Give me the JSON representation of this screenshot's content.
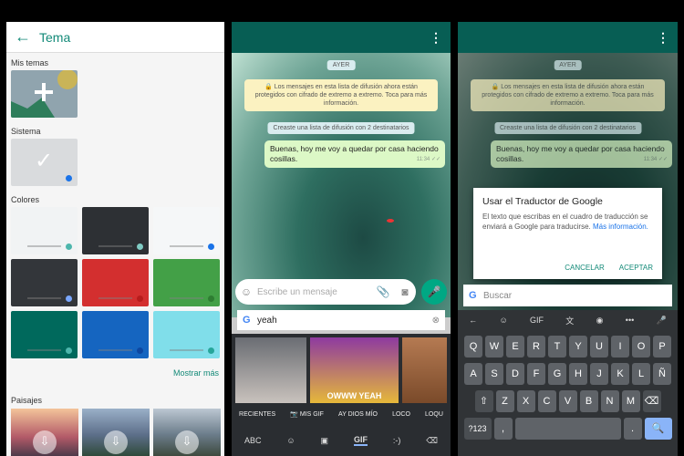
{
  "theme_panel": {
    "title": "Tema",
    "sections": {
      "my_themes": "Mis temas",
      "system": "Sistema",
      "colors": "Colores",
      "landscapes": "Paisajes"
    },
    "show_more": "Mostrar más",
    "color_tiles": [
      {
        "bg": "#f1f3f4",
        "dot": "#4db6ac"
      },
      {
        "bg": "#2d3034",
        "dot": "#80cbc4"
      },
      {
        "bg": "#f5f7f8",
        "dot": "#1a73e8"
      },
      {
        "bg": "#33363a",
        "dot": "#7aa7ff"
      },
      {
        "bg": "#d32f2f",
        "dot": "#b71c1c"
      },
      {
        "bg": "#43a047",
        "dot": "#2e7d32"
      },
      {
        "bg": "#00695c",
        "dot": "#4db6ac"
      },
      {
        "bg": "#1565c0",
        "dot": "#0d47a1"
      },
      {
        "bg": "#80deea",
        "dot": "#26a69a"
      }
    ]
  },
  "chat_gif": {
    "date_chip": "AYER",
    "system_msg": "🔒 Los mensajes en esta lista de difusión ahora están protegidos con cifrado de extremo a extremo. Toca para más información.",
    "broadcast_note": "Creaste una lista de difusión con 2 destinatarios",
    "bubble_text": "Buenas, hoy me voy a quedar por casa haciendo cosillas.",
    "bubble_time": "11:34 ✓✓",
    "input_placeholder": "Escribe un mensaje",
    "search_value": "yeah",
    "gif_caption": "OWWW YEAH",
    "categories": [
      "RECIENTES",
      "📷 MIS GIF",
      "AY DIOS MÍO",
      "LOCO",
      "LOQU"
    ],
    "nav": [
      "ABC",
      "☺",
      "▣",
      "GIF",
      ":-)",
      "⌫"
    ]
  },
  "chat_translate": {
    "dialog_title": "Usar el Traductor de Google",
    "dialog_body": "El texto que escribas en el cuadro de traducción se enviará a Google para traducirse.",
    "dialog_link": "Más información.",
    "cancel": "CANCELAR",
    "accept": "ACEPTAR",
    "search_placeholder": "Buscar",
    "tool_icons": [
      "←",
      "☺",
      "GIF",
      "文",
      "◉",
      "•••",
      "🎤"
    ],
    "keyboard": {
      "row1": [
        "Q",
        "W",
        "E",
        "R",
        "T",
        "Y",
        "U",
        "I",
        "O",
        "P"
      ],
      "row2": [
        "A",
        "S",
        "D",
        "F",
        "G",
        "H",
        "J",
        "K",
        "L",
        "Ñ"
      ],
      "row3": [
        "⇧",
        "Z",
        "X",
        "C",
        "V",
        "B",
        "N",
        "M",
        "⌫"
      ],
      "row4": [
        "?123",
        ",",
        "",
        ".",
        "🔍"
      ]
    }
  }
}
